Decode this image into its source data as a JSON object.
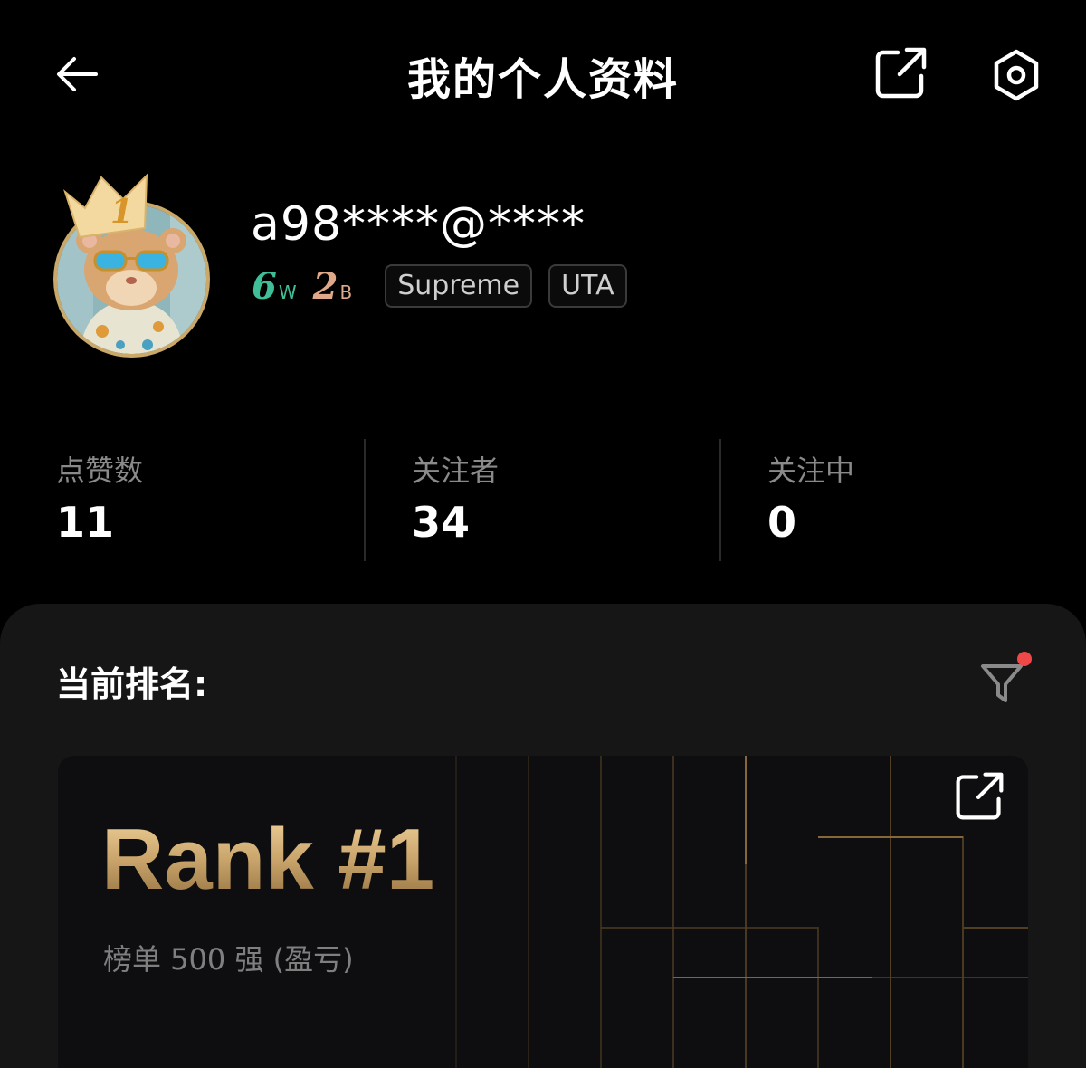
{
  "header": {
    "title": "我的个人资料",
    "back_icon": "arrow-left-icon",
    "share_icon": "external-link-icon",
    "settings_icon": "hexagon-settings-icon"
  },
  "profile": {
    "username": "a98****@****",
    "crown_rank": "1",
    "counts": [
      {
        "num": "6",
        "unit": "W"
      },
      {
        "num": "2",
        "unit": "B"
      }
    ],
    "tags": [
      "Supreme",
      "UTA"
    ]
  },
  "stats": [
    {
      "label": "点赞数",
      "value": "11"
    },
    {
      "label": "关注者",
      "value": "34"
    },
    {
      "label": "关注中",
      "value": "0"
    }
  ],
  "ranking": {
    "heading": "当前排名:",
    "card_title": "Rank #1",
    "card_subtitle": "榜单 500 强 (盈亏)",
    "filter_icon": "filter-icon",
    "filter_has_notification": true
  },
  "colors": {
    "background": "#000000",
    "panel": "#161616",
    "gold": "#c9a46b",
    "notification_dot": "#f04848",
    "w_badge": "#3fbf98",
    "b_badge": "#e0a889"
  }
}
